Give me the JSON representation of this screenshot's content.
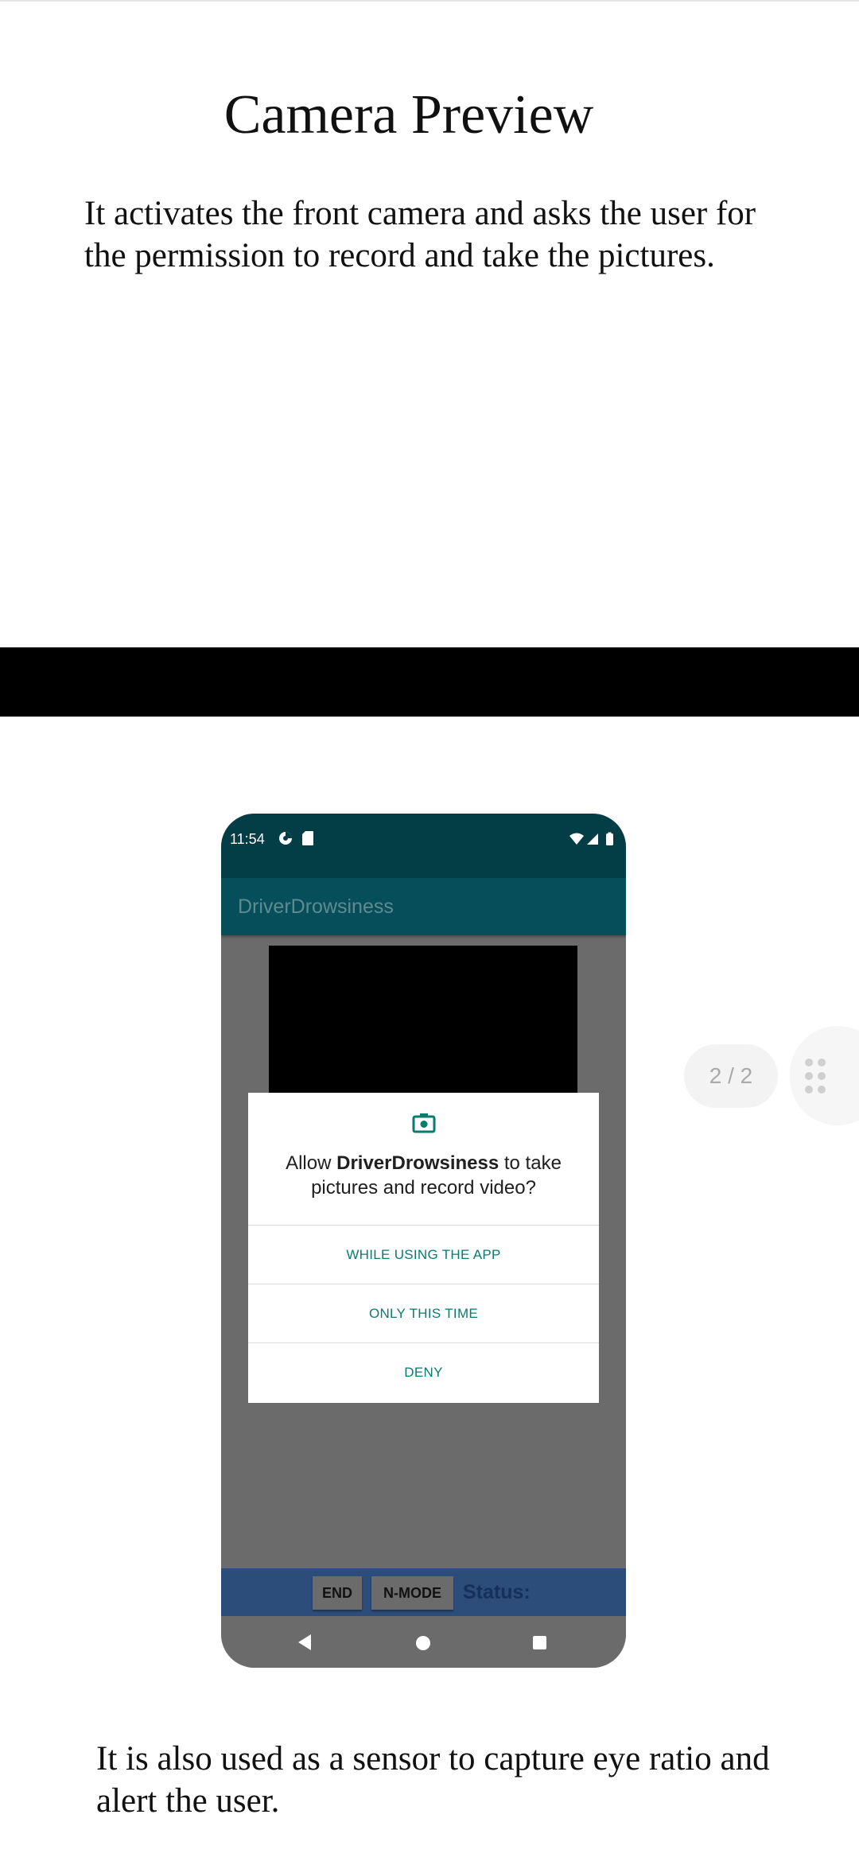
{
  "document": {
    "title": "Camera Preview",
    "paragraph_1": "It activates the front camera and asks the user for the permission to record and take the pictures.",
    "paragraph_2": "It is also used as a sensor to capture eye ratio and alert the user."
  },
  "phone": {
    "status_bar": {
      "time": "11:54",
      "icons": [
        "data-saver-icon",
        "sd-card-icon",
        "wifi-icon",
        "signal-icon",
        "battery-icon"
      ]
    },
    "app_bar": {
      "title": "DriverDrowsiness"
    },
    "permission_dialog": {
      "icon": "camera-icon",
      "message_prefix": "Allow ",
      "app_name": "DriverDrowsiness",
      "message_suffix": " to take pictures and record video?",
      "buttons": [
        "WHILE USING THE APP",
        "ONLY THIS TIME",
        "DENY"
      ]
    },
    "bottom_controls": {
      "end_label": "END",
      "nmode_label": "N-MODE",
      "status_label": "Status:"
    },
    "nav_bar": {
      "icons": [
        "back-icon",
        "home-icon",
        "recents-icon"
      ]
    }
  },
  "viewer": {
    "page_indicator": "2 / 2"
  },
  "colors": {
    "status_bar": "#033e47",
    "app_bar": "#064f5a",
    "dialog_accent": "#0b7a70",
    "bottom_bar": "#2c4c7a",
    "scrim": "#6b6b6b"
  }
}
